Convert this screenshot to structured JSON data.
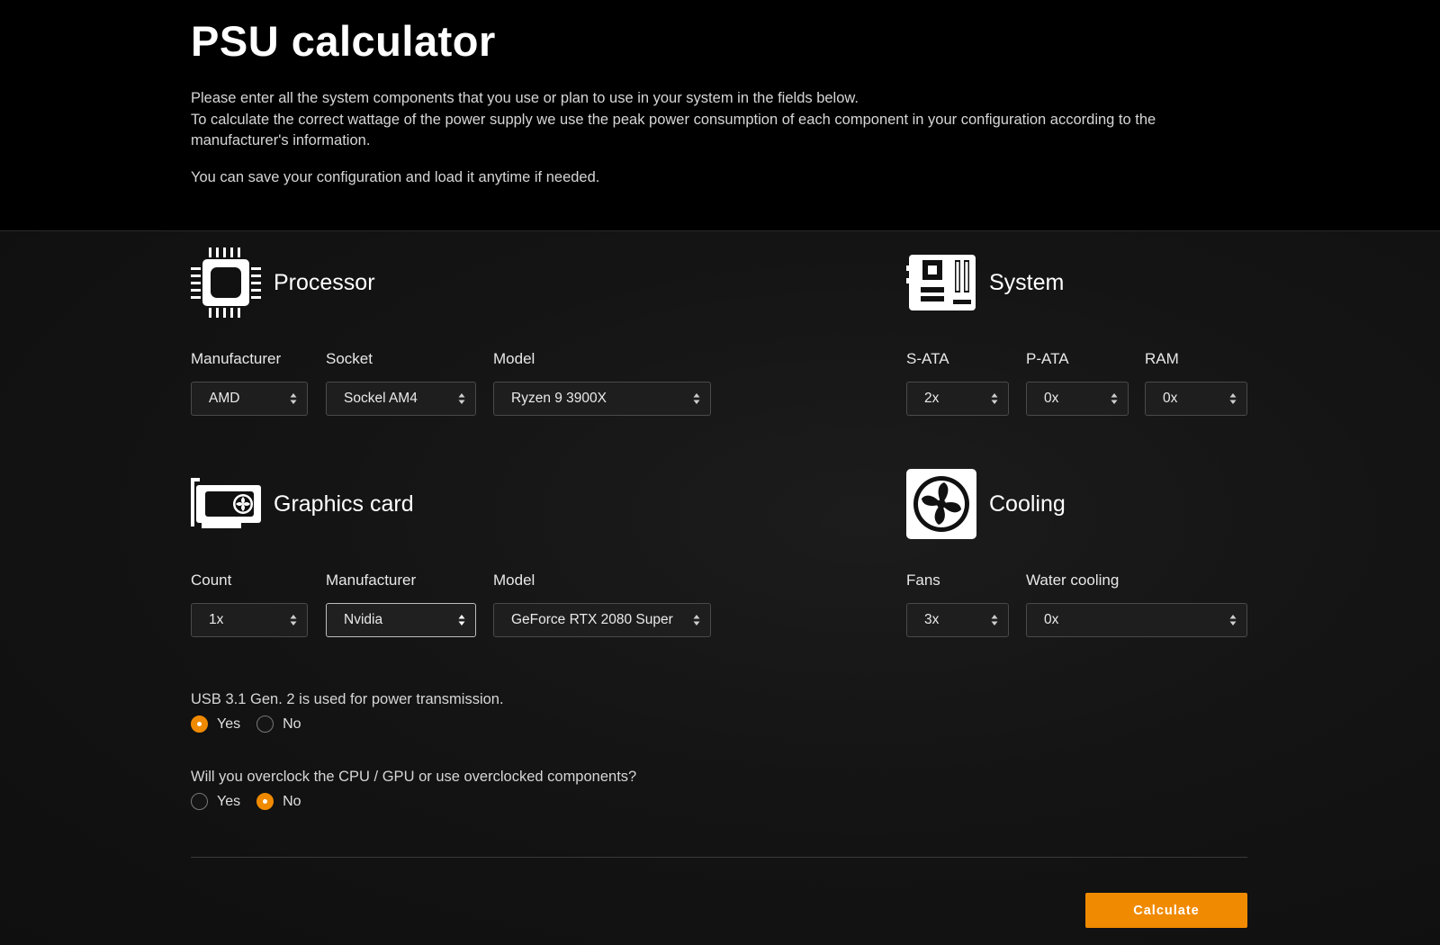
{
  "header": {
    "title": "PSU calculator",
    "intro_line1": "Please enter all the system components that you use or plan to use in your system in the fields below.",
    "intro_line2": "To calculate the correct wattage of the power supply we use the peak power consumption of each component in your configuration according to the manufacturer's information.",
    "intro_line3": "You can save your configuration and load it anytime if needed."
  },
  "processor": {
    "title": "Processor",
    "icon": "cpu-icon",
    "manufacturer": {
      "label": "Manufacturer",
      "value": "AMD"
    },
    "socket": {
      "label": "Socket",
      "value": "Sockel AM4"
    },
    "model": {
      "label": "Model",
      "value": "Ryzen 9 3900X"
    }
  },
  "system": {
    "title": "System",
    "icon": "motherboard-icon",
    "sata": {
      "label": "S-ATA",
      "value": "2x"
    },
    "pata": {
      "label": "P-ATA",
      "value": "0x"
    },
    "ram": {
      "label": "RAM",
      "value": "0x"
    }
  },
  "graphics": {
    "title": "Graphics card",
    "icon": "graphics-card-icon",
    "count": {
      "label": "Count",
      "value": "1x"
    },
    "manufacturer": {
      "label": "Manufacturer",
      "value": "Nvidia"
    },
    "model": {
      "label": "Model",
      "value": "GeForce RTX 2080 Super"
    }
  },
  "cooling": {
    "title": "Cooling",
    "icon": "fan-icon",
    "fans": {
      "label": "Fans",
      "value": "3x"
    },
    "water": {
      "label": "Water cooling",
      "value": "0x"
    }
  },
  "usb_question": {
    "text": "USB 3.1 Gen. 2 is used for power transmission.",
    "yes": "Yes",
    "no": "No",
    "selected": "Yes"
  },
  "overclock_question": {
    "text": "Will you overclock the CPU / GPU or use overclocked components?",
    "yes": "Yes",
    "no": "No",
    "selected": "No"
  },
  "calculate_label": "Calculate",
  "colors": {
    "accent": "#f08a00",
    "header_bg": "#000000",
    "body_bg": "#111111"
  }
}
